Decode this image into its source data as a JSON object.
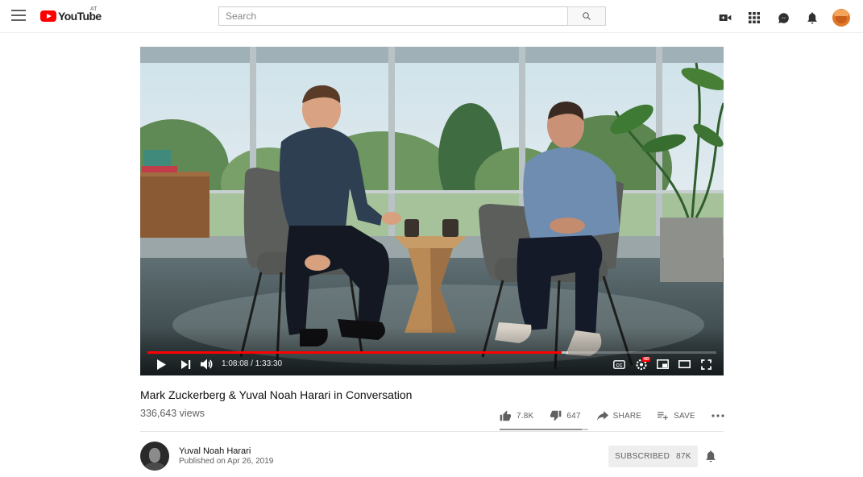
{
  "header": {
    "logo_text": "YouTube",
    "logo_country": "AT",
    "search_placeholder": "Search",
    "icons": [
      "menu-icon",
      "search-icon",
      "create-video-icon",
      "apps-icon",
      "messages-icon",
      "notifications-icon",
      "account-avatar"
    ]
  },
  "player": {
    "time_current": "1:08:08",
    "time_separator": " / ",
    "time_total": "1:33:30",
    "progress_played_fraction": 0.7287,
    "progress_buffered_fraction": 0.74,
    "hd_badge": "HD",
    "controls": [
      "play-icon",
      "next-icon",
      "volume-icon",
      "captions-icon",
      "settings-icon",
      "miniplayer-icon",
      "theater-icon",
      "fullscreen-icon"
    ]
  },
  "video": {
    "title": "Mark Zuckerberg & Yuval Noah Harari in Conversation",
    "views": "336,643 views",
    "likes": "7.8K",
    "dislikes": "647",
    "share_label": "SHARE",
    "save_label": "SAVE",
    "like_ratio": 0.923
  },
  "channel": {
    "name": "Yuval Noah Harari",
    "published": "Published on Apr 26, 2019",
    "subscribe_label": "SUBSCRIBED",
    "subscriber_count": "87K"
  },
  "colors": {
    "brand_red": "#ff0000",
    "text_primary": "#0f0f0f",
    "text_secondary": "#606060"
  }
}
